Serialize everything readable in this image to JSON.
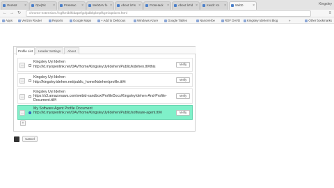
{
  "browser": {
    "tabs": [
      {
        "label": "OneNot"
      },
      {
        "label": "Ope|Dic"
      },
      {
        "label": "ProteHac"
      },
      {
        "label": "WebDAV fe"
      },
      {
        "label": "About: kFis"
      },
      {
        "label": "ProteHack"
      },
      {
        "label": "About: kFid"
      },
      {
        "label": "Kasdr: Kn"
      },
      {
        "label": "WebD"
      }
    ],
    "profile_name": "Kingsley",
    "url": "chrome-extension://cgfkmiblhidapefgofpdbkpbnpfkgm/options.html",
    "bookmarks": [
      {
        "label": "Apps"
      },
      {
        "label": "Verizon Router"
      },
      {
        "label": "Reports"
      },
      {
        "label": "Google Maps"
      },
      {
        "label": "+ Add to Delicious"
      },
      {
        "label": "Windows Azure"
      },
      {
        "label": "Google Tables"
      },
      {
        "label": "NanoVerbe"
      },
      {
        "label": "RDF DAVD"
      },
      {
        "label": "Kingsley Idehen's Blog"
      },
      {
        "label": "»"
      }
    ],
    "other_bookmarks": "Other bookmarks"
  },
  "options": {
    "tabs": [
      "Profile List",
      "Header Settings",
      "About"
    ],
    "rows": [
      {
        "title": "Kingsley Uyi Idehen",
        "url": "http://id.myopenlink.net/DAV/home/KingsleyUyiIdehen/Public/kidehen.ttl#this",
        "edit": "Verify",
        "selected": false
      },
      {
        "title": "Kingsley Uyi Idehen",
        "url": "http://kingsley.idehen.net/public_home/kidehen/profile.ttl#i",
        "edit": "Verify",
        "selected": false
      },
      {
        "title": "Kingsley Uyi Idehen",
        "url": "https://s3.amazonaws.com/webid-sandbox/ProfileDocs/KingsleyIdehen-And-Profile-Document.ttl#i",
        "edit": "Verify",
        "selected": false
      },
      {
        "title": "My Software Agent Profile Document",
        "url": "http://id.myopenlink.net/DAV/home/KingsleyUyiIdehen/Public/software-agent.ttl#i",
        "edit": "Verify",
        "selected": true
      }
    ],
    "add_label": "+",
    "handle_label": "—",
    "cancel_label": "Cancel"
  }
}
